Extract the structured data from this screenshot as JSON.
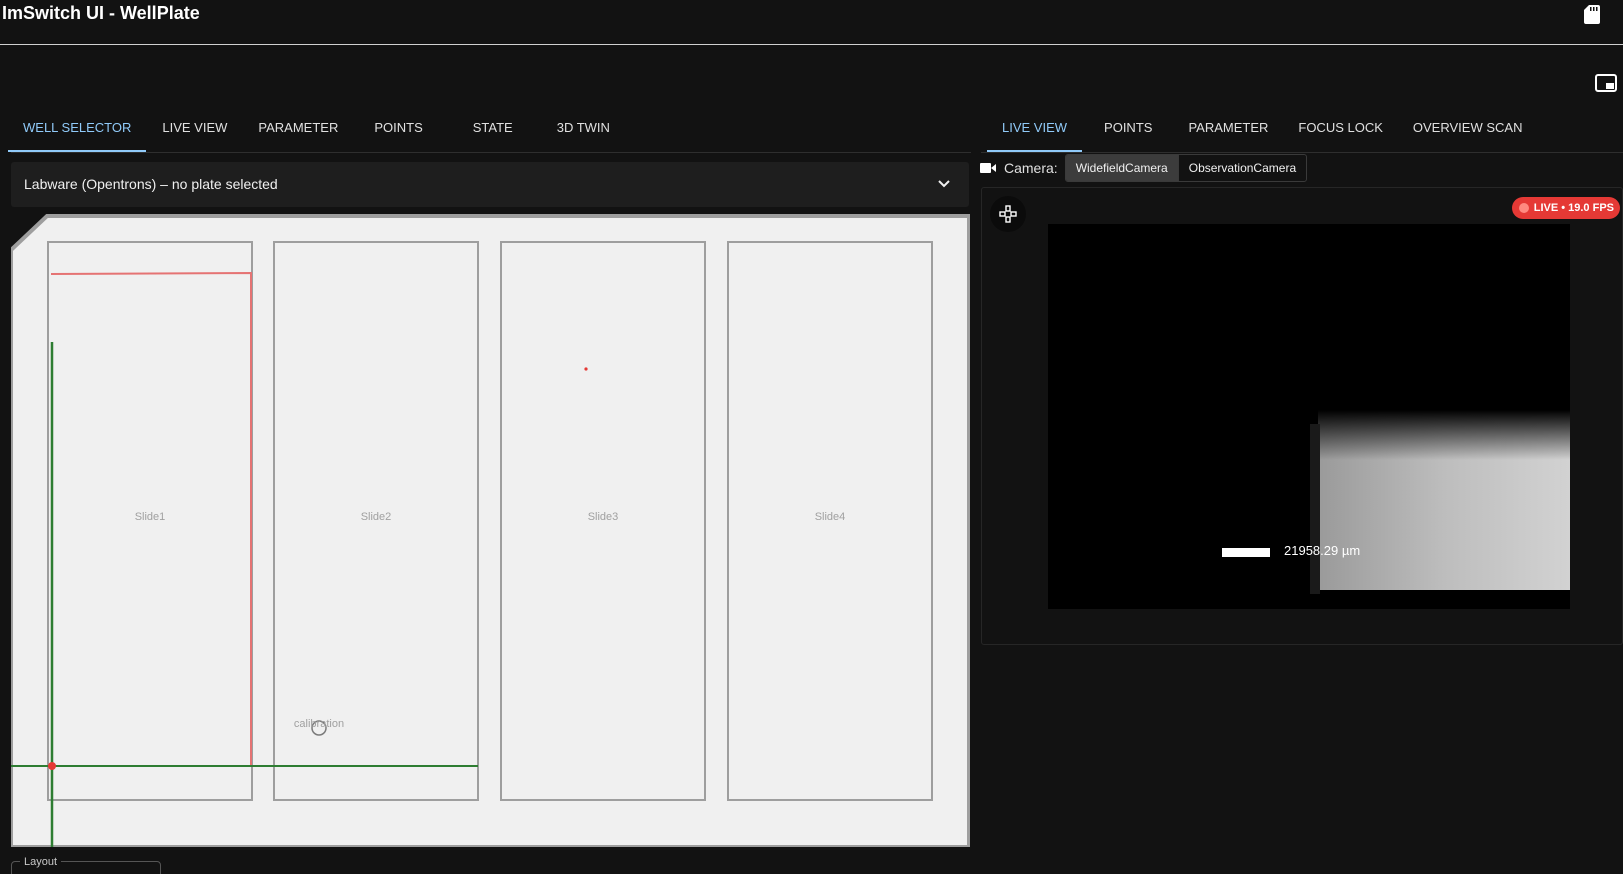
{
  "app": {
    "title": "ImSwitch UI - WellPlate"
  },
  "left_tabs": [
    {
      "label": "WELL SELECTOR",
      "active": true
    },
    {
      "label": "LIVE VIEW",
      "active": false
    },
    {
      "label": "PARAMETER",
      "active": false
    },
    {
      "label": "POINTS",
      "active": false
    },
    {
      "label": "STATE",
      "active": false
    },
    {
      "label": "3D TWIN",
      "active": false
    }
  ],
  "right_tabs": [
    {
      "label": "LIVE VIEW",
      "active": true
    },
    {
      "label": "POINTS",
      "active": false
    },
    {
      "label": "PARAMETER",
      "active": false
    },
    {
      "label": "FOCUS LOCK",
      "active": false
    },
    {
      "label": "OVERVIEW SCAN",
      "active": false
    }
  ],
  "labware": {
    "label": "Labware (Opentrons) – no plate selected"
  },
  "plate": {
    "slides": [
      "Slide1",
      "Slide2",
      "Slide3",
      "Slide4"
    ],
    "calibration_label": "calibration"
  },
  "layout_field": {
    "label": "Layout"
  },
  "camera": {
    "label": "Camera:",
    "options": [
      "WidefieldCamera",
      "ObservationCamera"
    ],
    "selected": "WidefieldCamera"
  },
  "live": {
    "badge": "LIVE • 19.0 FPS",
    "scale_label": "21958.29 µm"
  },
  "colors": {
    "accent": "#90caf9",
    "live_badge": "#e53935",
    "crosshair_red": "#e57373",
    "crosshair_green": "#2e7d32"
  }
}
